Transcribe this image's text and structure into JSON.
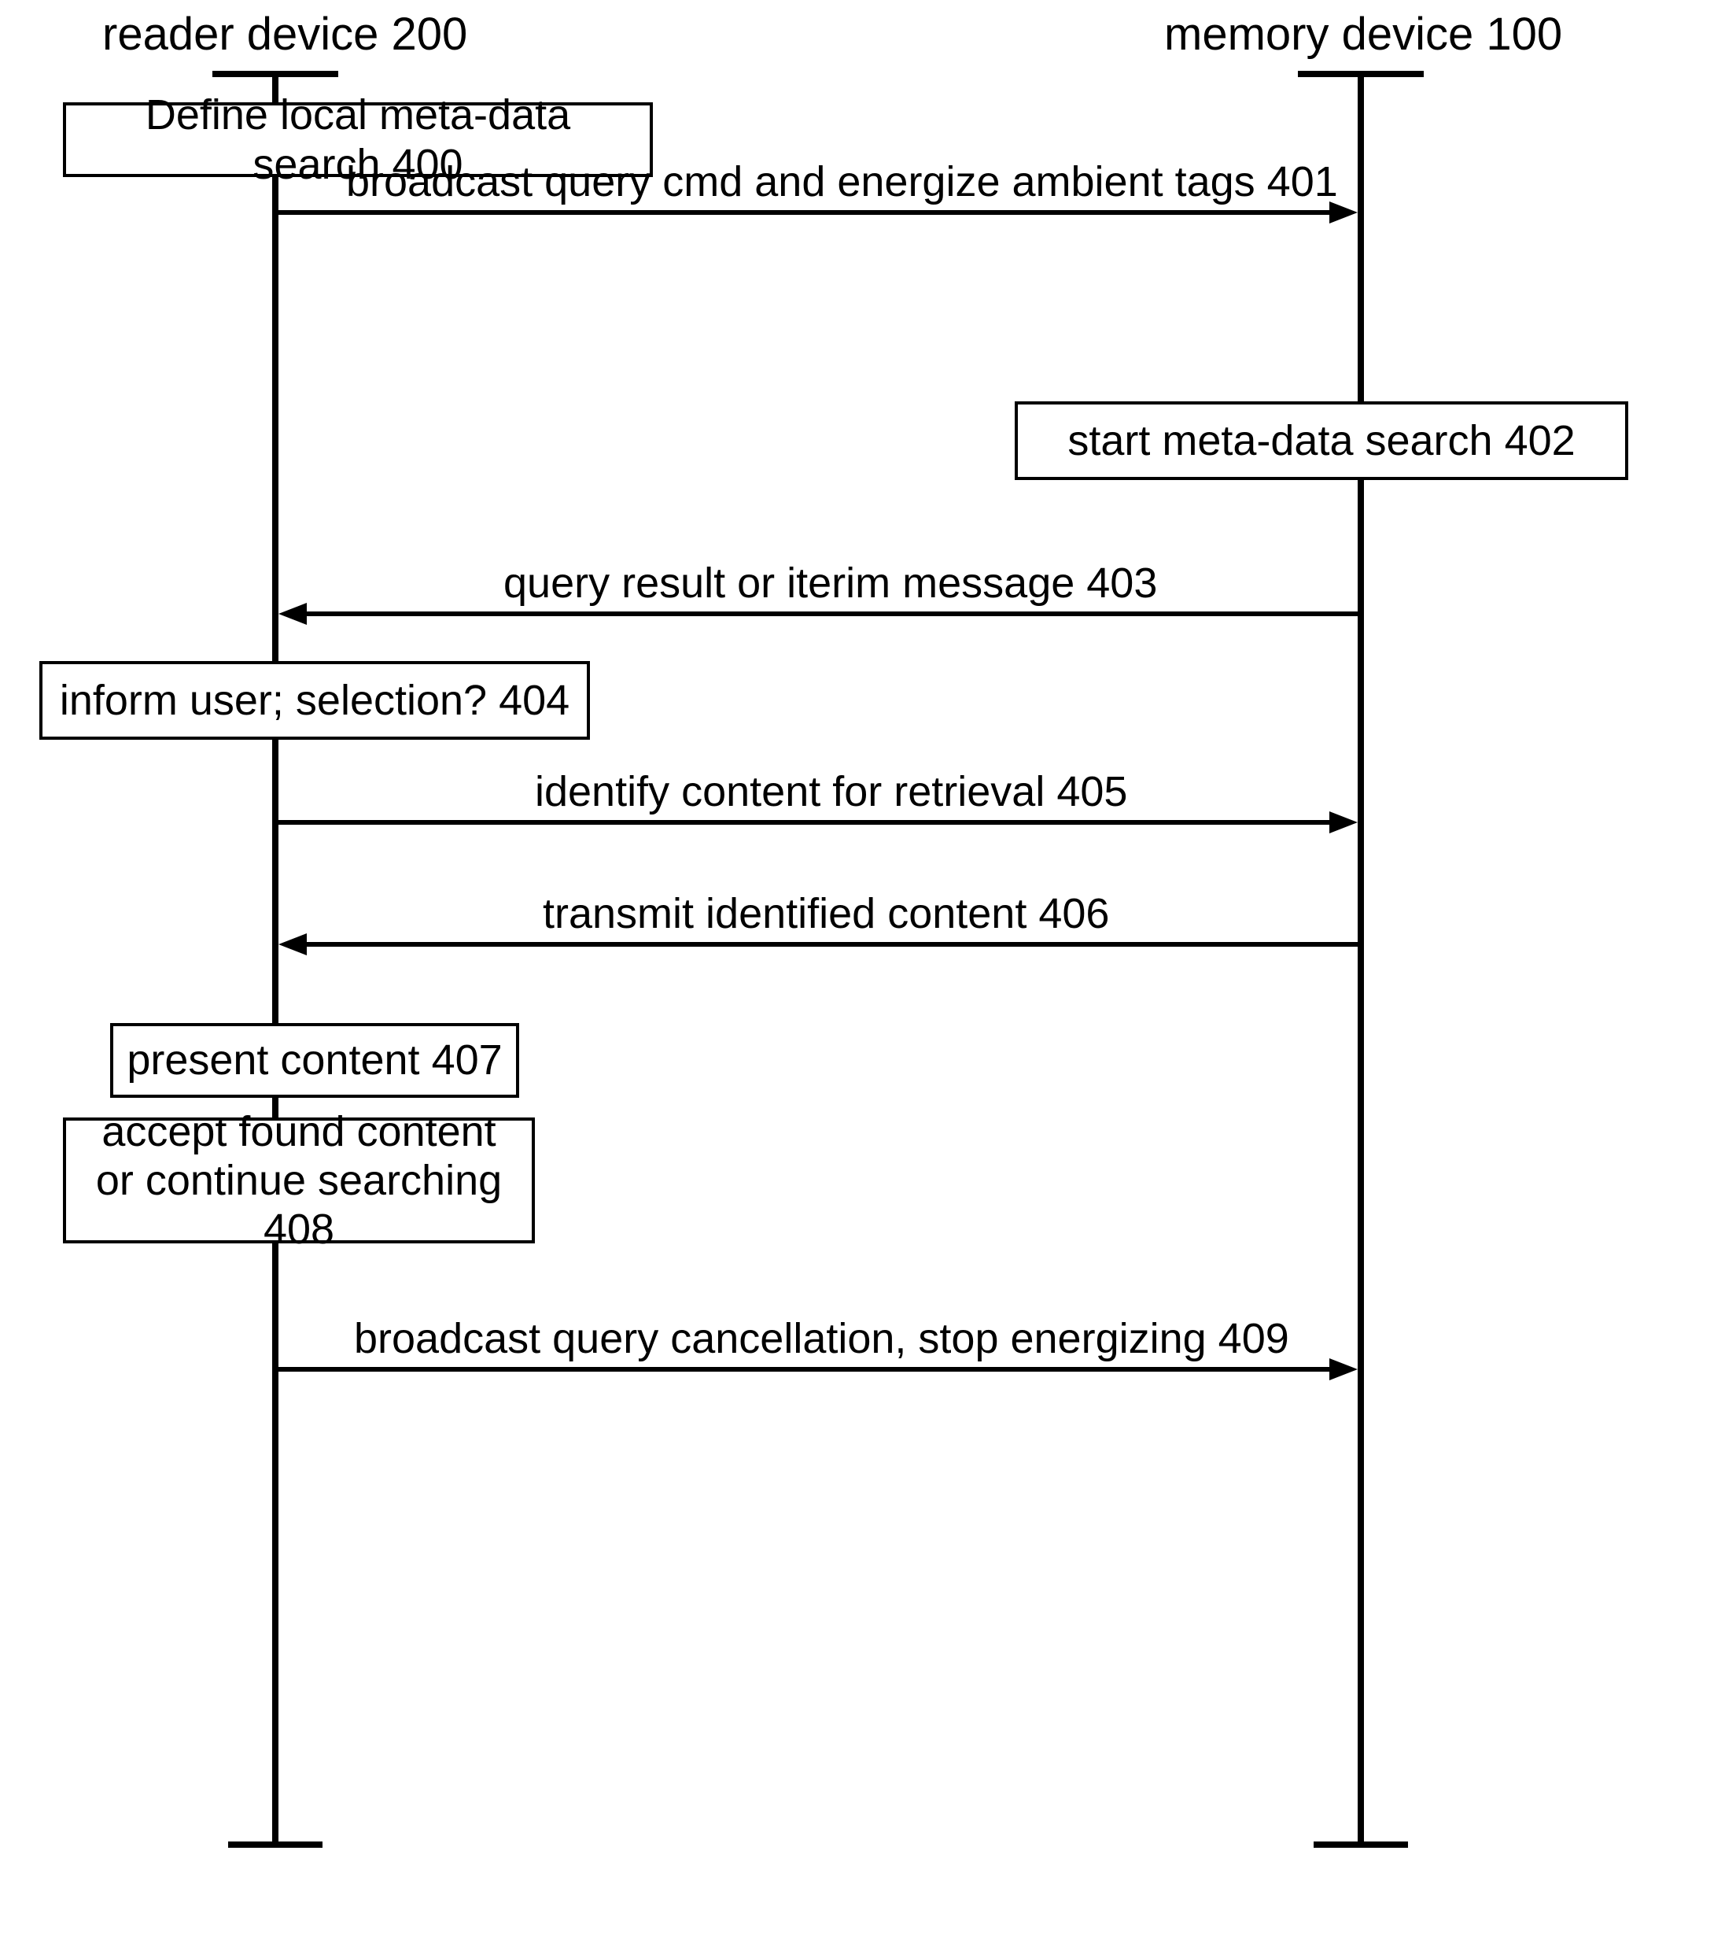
{
  "participants": {
    "reader": "reader device 200",
    "memory": "memory device 100"
  },
  "boxes": {
    "b400": "Define local meta-data search 400",
    "b402": "start meta-data search 402",
    "b404": "inform user; selection? 404",
    "b407": "present content 407",
    "b408": "accept found content or continue searching 408"
  },
  "messages": {
    "m401": "broadcast query cmd and energize ambient tags 401",
    "m403": "query result or iterim message 403",
    "m405": "identify content for retrieval 405",
    "m406": "transmit identified content 406",
    "m409": "broadcast query cancellation, stop energizing 409"
  },
  "chart_data": {
    "type": "sequence-diagram",
    "participants": [
      {
        "id": "reader",
        "label": "reader device 200"
      },
      {
        "id": "memory",
        "label": "memory device 100"
      }
    ],
    "steps": [
      {
        "n": 400,
        "kind": "action",
        "at": "reader",
        "text": "Define local meta-data search"
      },
      {
        "n": 401,
        "kind": "message",
        "from": "reader",
        "to": "memory",
        "text": "broadcast query cmd and energize ambient tags"
      },
      {
        "n": 402,
        "kind": "action",
        "at": "memory",
        "text": "start meta-data search"
      },
      {
        "n": 403,
        "kind": "message",
        "from": "memory",
        "to": "reader",
        "text": "query result or iterim message"
      },
      {
        "n": 404,
        "kind": "action",
        "at": "reader",
        "text": "inform user; selection?"
      },
      {
        "n": 405,
        "kind": "message",
        "from": "reader",
        "to": "memory",
        "text": "identify content for retrieval"
      },
      {
        "n": 406,
        "kind": "message",
        "from": "memory",
        "to": "reader",
        "text": "transmit identified content"
      },
      {
        "n": 407,
        "kind": "action",
        "at": "reader",
        "text": "present content"
      },
      {
        "n": 408,
        "kind": "action",
        "at": "reader",
        "text": "accept found content or continue searching"
      },
      {
        "n": 409,
        "kind": "message",
        "from": "reader",
        "to": "memory",
        "text": "broadcast query cancellation, stop energizing"
      }
    ]
  }
}
